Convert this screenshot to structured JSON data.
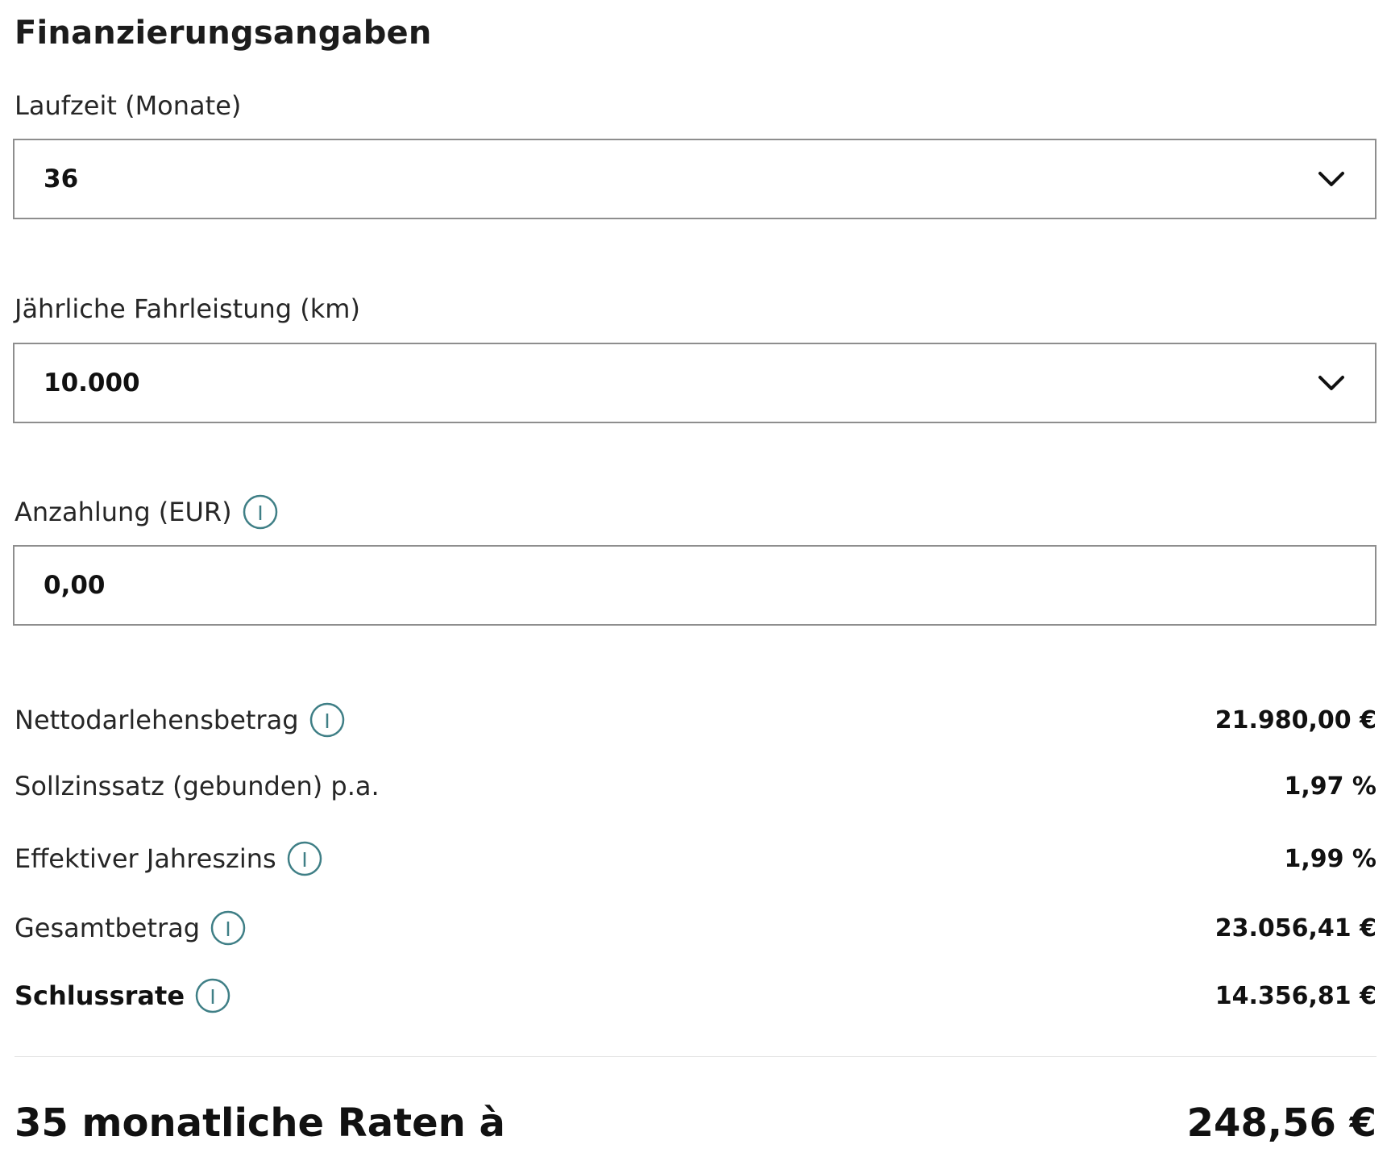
{
  "section": {
    "title": "Finanzierungsangaben"
  },
  "laufzeit": {
    "label": "Laufzeit (Monate)",
    "value": "36",
    "icon": "chevron-down-icon"
  },
  "fahrleistung": {
    "label": "Jährliche Fahrleistung (km)",
    "value": "10.000",
    "icon": "chevron-down-icon"
  },
  "anzahlung": {
    "label": "Anzahlung (EUR)",
    "value": "0,00",
    "icon": "info-icon"
  },
  "summary": {
    "nettodarlehensbetrag": {
      "label": "Nettodarlehensbetrag",
      "value": "21.980,00 €"
    },
    "sollzinssatz": {
      "label": "Sollzinssatz (gebunden) p.a.",
      "value": "1,97 %"
    },
    "effektiver_jahreszins": {
      "label": "Effektiver Jahreszins",
      "value": "1,99 %"
    },
    "gesamtbetrag": {
      "label": "Gesamtbetrag",
      "value": "23.056,41 €"
    },
    "schlussrate": {
      "label": "Schlussrate",
      "value": "14.356,81 €"
    }
  },
  "total": {
    "label": "35 monatliche Raten à",
    "value": "248,56 €"
  },
  "colors": {
    "info_accent": "#3f7f86",
    "border": "#8e8e8e",
    "text": "#1c1c1c"
  }
}
